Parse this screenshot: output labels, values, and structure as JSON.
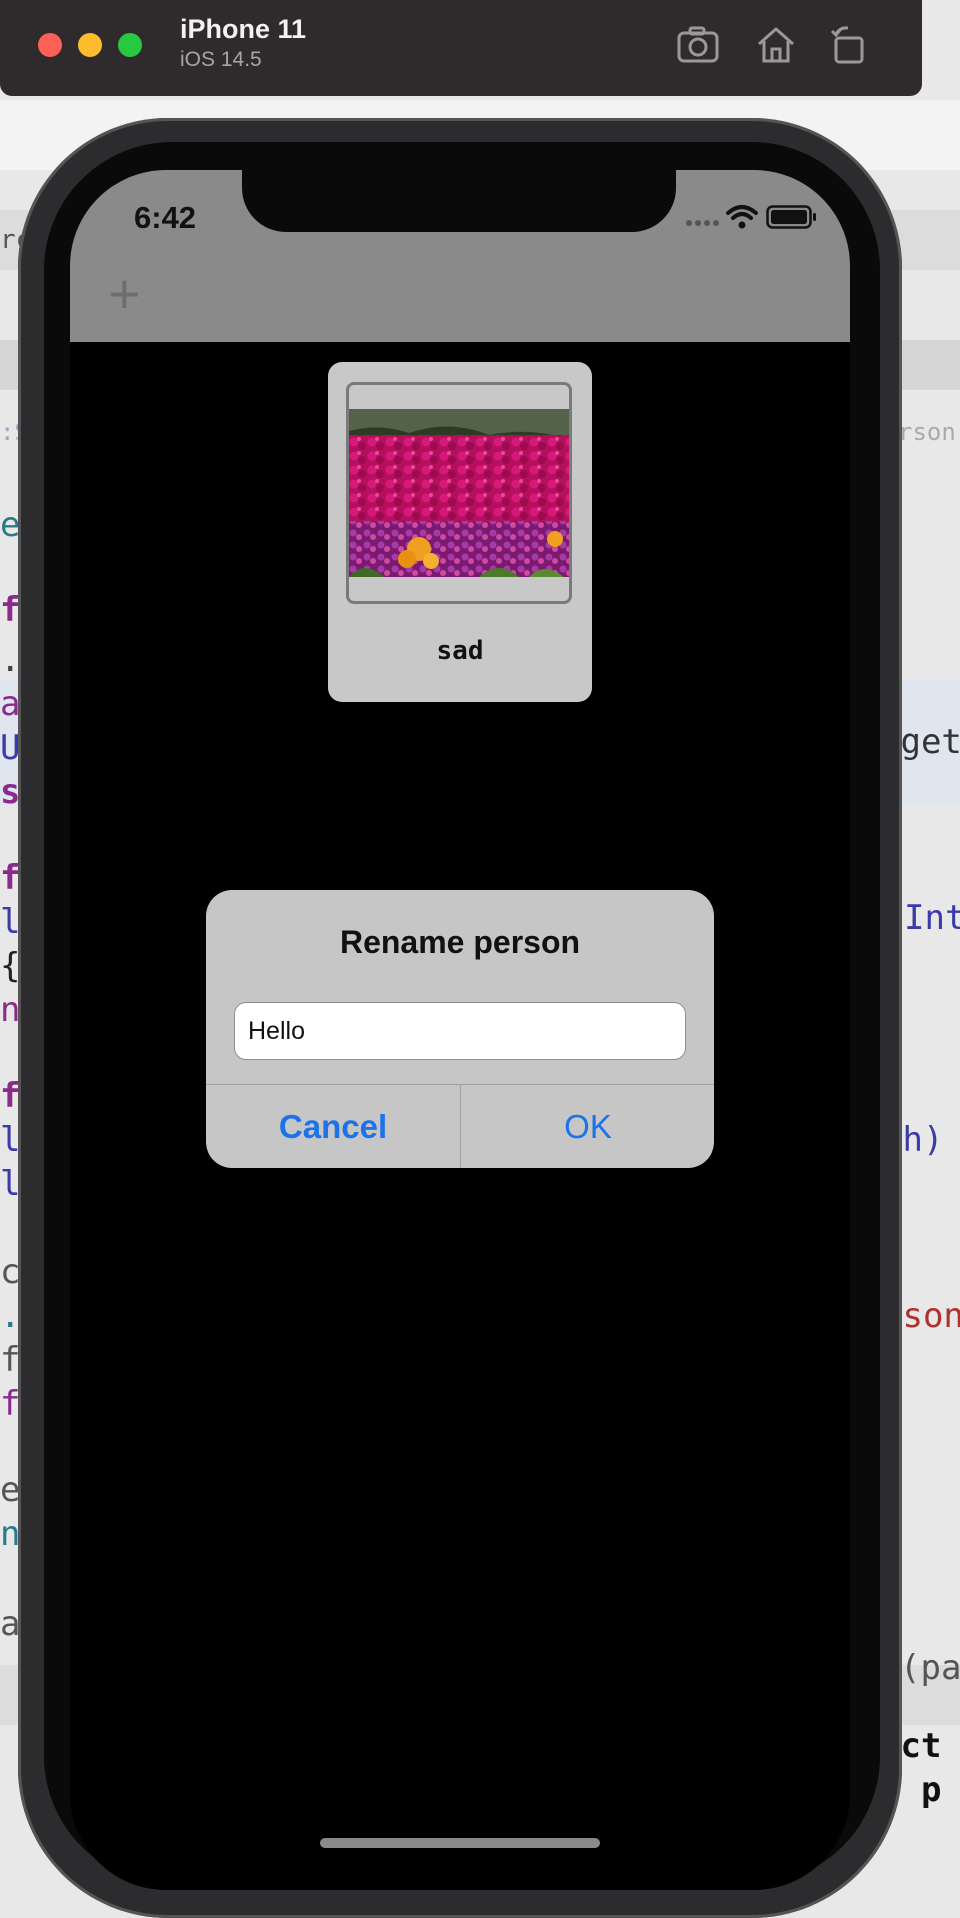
{
  "simulator": {
    "device": "iPhone 11",
    "os": "iOS 14.5",
    "icons": [
      "screenshot-icon",
      "home-icon",
      "rotate-icon"
    ]
  },
  "status_bar": {
    "time": "6:42"
  },
  "navbar": {
    "add_label": "+"
  },
  "card": {
    "label": "sad"
  },
  "alert": {
    "title": "Rename person",
    "input_value": "Hello",
    "cancel_label": "Cancel",
    "ok_label": "OK"
  },
  "background_code": {
    "left": [
      "rc",
      ":S",
      "e",
      "fu",
      ".",
      "a",
      "U",
      "se",
      "fu",
      "li",
      "{",
      "n",
      "fu",
      "li",
      "li",
      "co",
      ".c",
      "fo",
      "fa",
      "ex",
      "na",
      "a"
    ],
    "right": [
      "rson",
      "rget",
      "Int",
      "th)",
      "rson",
      "(pa",
      "ect",
      ": p"
    ]
  },
  "colors": {
    "accent": "#1a73e8",
    "navbar": "#8a8a8a",
    "alert_bg": "#c6c6c6"
  }
}
